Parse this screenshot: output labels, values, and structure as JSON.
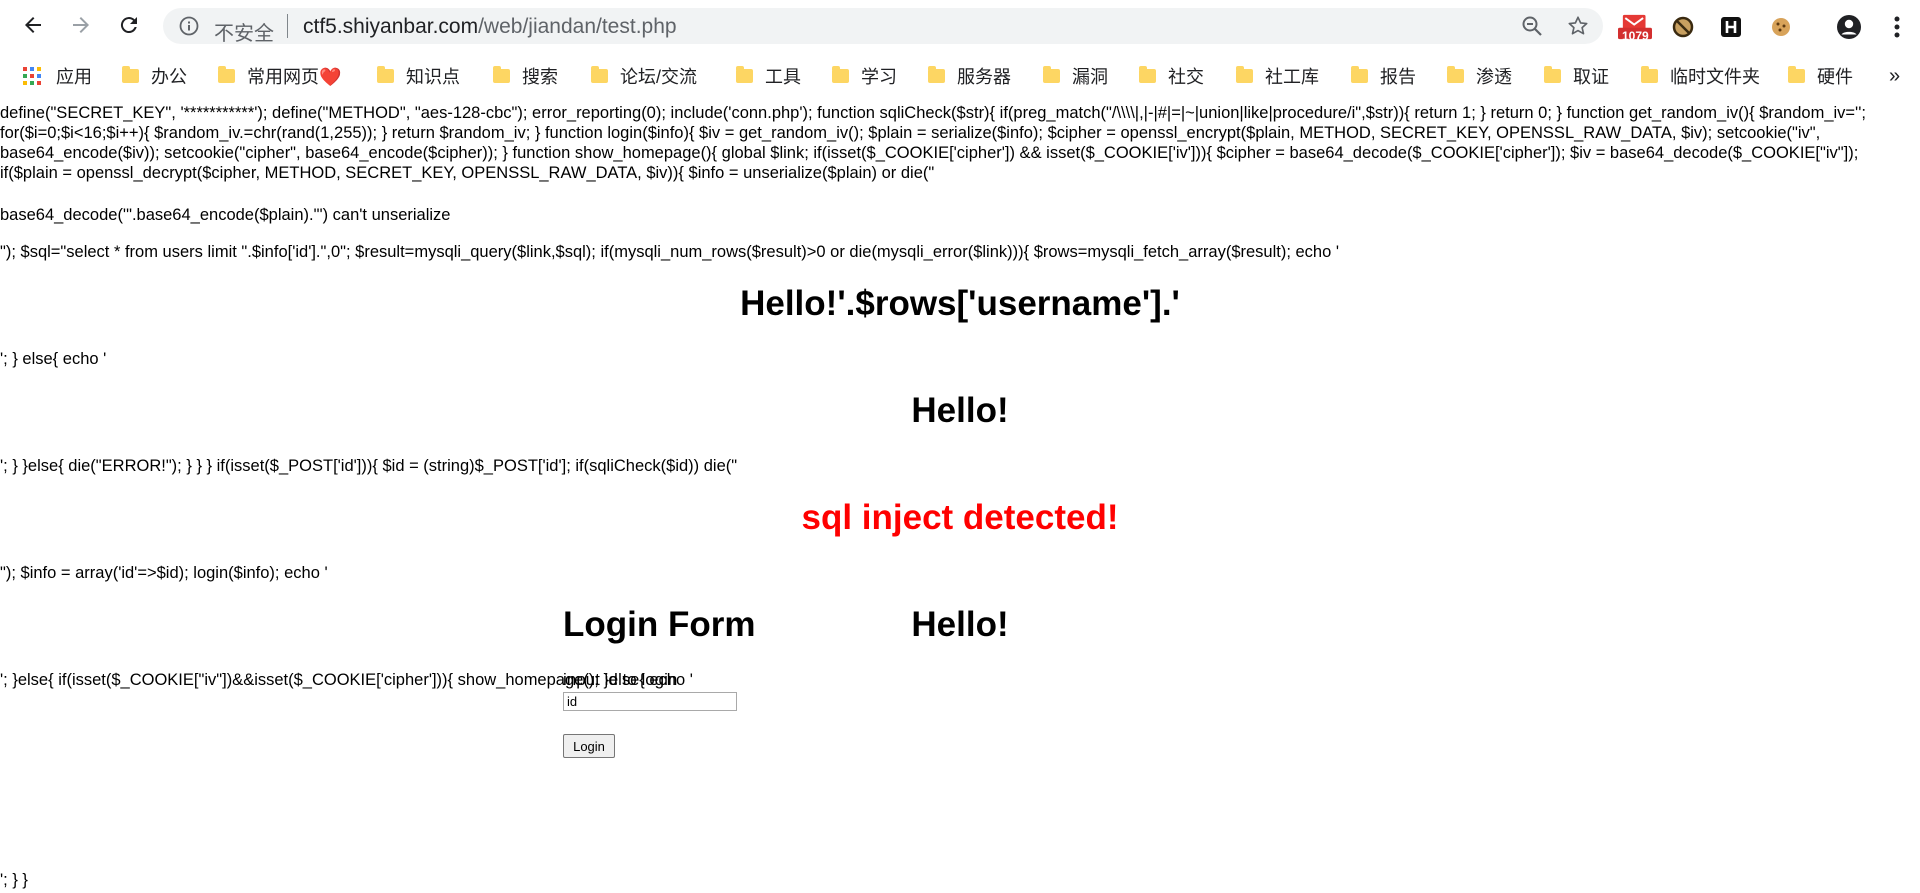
{
  "browser": {
    "insecure_label": "不安全",
    "url_host": "ctf5.shiyanbar.com",
    "url_path": "/web/jiandan/test.php",
    "ext_badge": "1079"
  },
  "bookmarks": [
    {
      "label": "应用"
    },
    {
      "label": "办公"
    },
    {
      "label": "常用网页❤️"
    },
    {
      "label": "知识点"
    },
    {
      "label": "搜索"
    },
    {
      "label": "论坛/交流"
    },
    {
      "label": "工具"
    },
    {
      "label": "学习"
    },
    {
      "label": "服务器"
    },
    {
      "label": "漏洞"
    },
    {
      "label": "社交"
    },
    {
      "label": "社工库"
    },
    {
      "label": "报告"
    },
    {
      "label": "渗透"
    },
    {
      "label": "取证"
    },
    {
      "label": "临时文件夹"
    },
    {
      "label": "硬件"
    }
  ],
  "bookmarks_more": "»",
  "page": {
    "code_block_1": "define(\"SECRET_KEY\", '***********'); define(\"METHOD\", \"aes-128-cbc\"); error_reporting(0); include('conn.php'); function sqliCheck($str){ if(preg_match(\"/\\\\\\\\|,|-|#|=|~|union|like|procedure/i\",$str)){ return 1; } return 0; } function get_random_iv(){ $random_iv=''; for($i=0;$i<16;$i++){ $random_iv.=chr(rand(1,255)); } return $random_iv; } function login($info){ $iv = get_random_iv(); $plain = serialize($info); $cipher = openssl_encrypt($plain, METHOD, SECRET_KEY, OPENSSL_RAW_DATA, $iv); setcookie(\"iv\", base64_encode($iv)); setcookie(\"cipher\", base64_encode($cipher)); } function show_homepage(){ global $link; if(isset($_COOKIE['cipher']) && isset($_COOKIE['iv'])){ $cipher = base64_decode($_COOKIE['cipher']); $iv = base64_decode($_COOKIE[\"iv\"]); if($plain = openssl_decrypt($cipher, METHOD, SECRET_KEY, OPENSSL_RAW_DATA, $iv)){ $info = unserialize($plain) or die(\"",
    "code_block_2": "base64_decode('\".base64_encode($plain).\"') can't unserialize",
    "code_block_3": "\"); $sql=\"select * from users limit \".$info['id'].\",0\"; $result=mysqli_query($link,$sql); if(mysqli_num_rows($result)>0 or die(mysqli_error($link))){ $rows=mysqli_fetch_array($result); echo '",
    "heading_1": "Hello!'.$rows['username'].'",
    "code_block_4": "'; } else{ echo '",
    "heading_2": "Hello!",
    "code_block_5": "'; } }else{ die(\"ERROR!\"); } } } if(isset($_POST['id'])){ $id = (string)$_POST['id']; if(sqliCheck($id)) die(\"",
    "heading_3": "sql inject detected!",
    "code_block_6": "\"); $info = array('id'=>$id); login($info); echo '",
    "heading_4": "Hello!",
    "code_block_7": "'; }else{ if(isset($_COOKIE[\"iv\"])&&isset($_COOKIE['cipher'])){ show_homepage(); }else{ echo '",
    "form_title": "Login Form",
    "form_label": "input id to login",
    "form_input_value": "id",
    "form_button": "Login",
    "code_block_8": "'; } }"
  }
}
